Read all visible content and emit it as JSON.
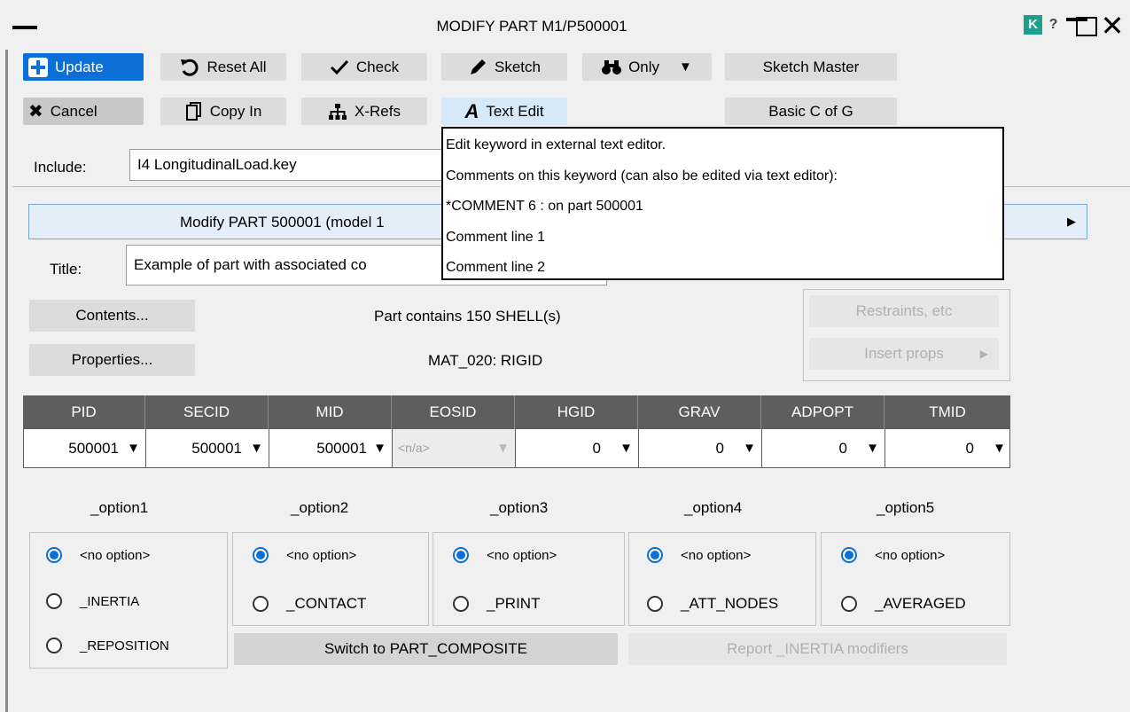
{
  "window": {
    "title": "MODIFY PART M1/P500001",
    "k_label": "K",
    "help_label": "?"
  },
  "toolbar": {
    "update": "Update",
    "reset_all": "Reset All",
    "check": "Check",
    "sketch": "Sketch",
    "only": "Only",
    "sketch_master": "Sketch Master",
    "cancel": "Cancel",
    "copy_in": "Copy In",
    "x_refs": "X-Refs",
    "text_edit": "Text Edit",
    "basic_c_of_g": "Basic C of G"
  },
  "include": {
    "label": "Include:",
    "value": "I4  LongitudinalLoad.key"
  },
  "modify_bar": {
    "text": "Modify PART 500001 (model 1"
  },
  "title_field": {
    "label": "Title:",
    "value": "Example of part with associated co"
  },
  "tooltip": {
    "lines": [
      "Edit keyword in external text editor.",
      "Comments on this keyword (can also be edited via text editor):",
      "*COMMENT 6 : on part 500001",
      "Comment line 1",
      "Comment line 2"
    ]
  },
  "info": {
    "contents_btn": "Contents...",
    "properties_btn": "Properties...",
    "part_contains": "Part contains 150 SHELL(s)",
    "material": "MAT_020: RIGID",
    "restraints_btn": "Restraints, etc",
    "insert_props_btn": "Insert props"
  },
  "table": {
    "headers": [
      "PID",
      "SECID",
      "MID",
      "EOSID",
      "HGID",
      "GRAV",
      "ADPOPT",
      "TMID"
    ],
    "values": [
      "500001",
      "500001",
      "500001",
      "<n/a>",
      "0",
      "0",
      "0",
      "0"
    ]
  },
  "options": {
    "labels": [
      "_option1",
      "_option2",
      "_option3",
      "_option4",
      "_option5"
    ],
    "groups": [
      [
        "<no option>",
        "_INERTIA",
        "_REPOSITION"
      ],
      [
        "<no option>",
        "_CONTACT"
      ],
      [
        "<no option>",
        "_PRINT"
      ],
      [
        "<no option>",
        "_ATT_NODES"
      ],
      [
        "<no option>",
        "_AVERAGED"
      ]
    ],
    "switch_btn": "Switch to PART_COMPOSITE",
    "report_btn": "Report _INERTIA modifiers"
  },
  "colors": {
    "accent": "#0a6fd6",
    "table_header": "#5e5e5e",
    "k_badge": "#1e9e8c"
  }
}
